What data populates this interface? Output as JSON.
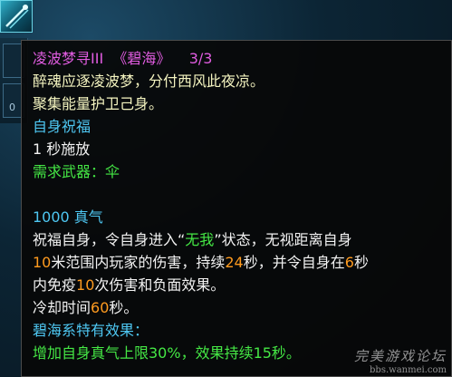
{
  "slots": {
    "count": "0"
  },
  "skill": {
    "name": "凌波梦寻III",
    "school_tag": "《碧海》",
    "level": "3/3",
    "desc1": "醉魂应逐凌波梦，分付西风此夜凉。",
    "desc2": "聚集能量护卫己身。",
    "category": "自身祝福",
    "cast_time": "1 秒施放",
    "weapon_req": "需求武器：伞",
    "cost": "1000 真气",
    "effect": {
      "p1": "祝福自身，令自身进入“",
      "state": "无我",
      "p2": "”状态，无视距离自身",
      "range": "10",
      "p3": "米范围内玩家的伤害，持续",
      "duration": "24",
      "p4": "秒，并令自身在",
      "immune_secs": "6",
      "p5": "秒",
      "p6": "内免疫",
      "immune_count": "10",
      "p7": "次伤害和负面效果。"
    },
    "cooldown": {
      "p1": "冷却时间",
      "value": "60",
      "p2": "秒。"
    },
    "school_effect_title": "碧海系特有效果：",
    "school_effect": "增加自身真气上限30%，效果持续15秒。"
  },
  "watermark": {
    "title": "完美游戏论坛",
    "url": "bbs.wanmei.com"
  },
  "colors": {
    "title": "#e05ce0",
    "cyan": "#4ec7f2",
    "green": "#45e845",
    "yellow": "#f4f4c0",
    "orange": "#ff9b1f"
  }
}
